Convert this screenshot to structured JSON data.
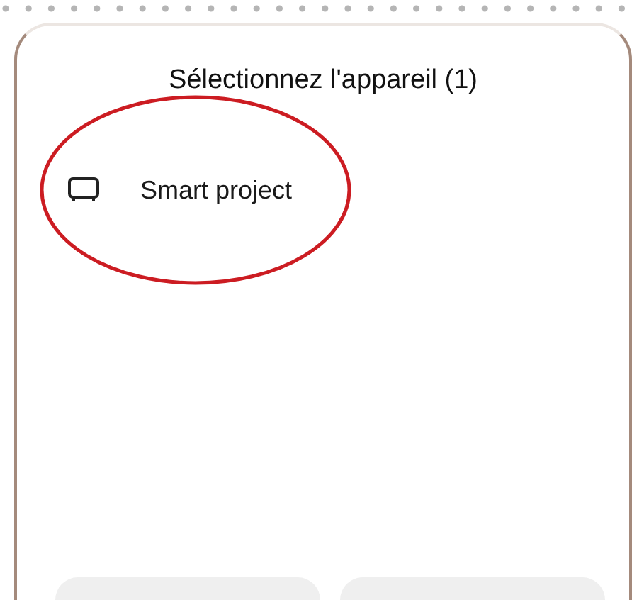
{
  "dialog": {
    "title": "Sélectionnez l'appareil (1)",
    "devices": [
      {
        "name": "Smart project",
        "highlighted": true
      }
    ]
  }
}
